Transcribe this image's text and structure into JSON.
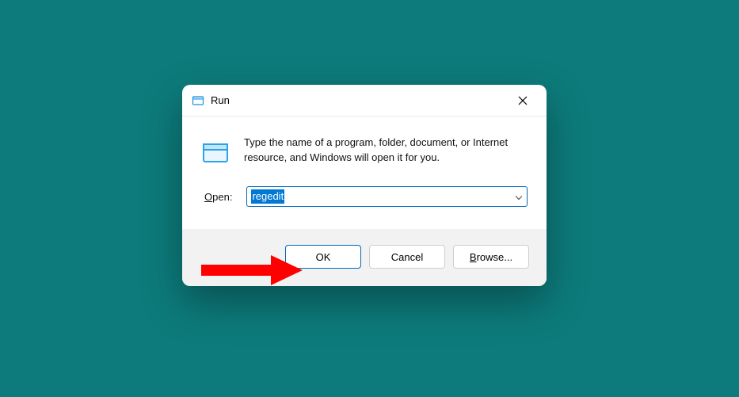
{
  "dialog": {
    "title": "Run",
    "description": "Type the name of a program, folder, document, or Internet resource, and Windows will open it for you.",
    "open_label_prefix": "O",
    "open_label_rest": "pen:",
    "input_value": "regedit",
    "buttons": {
      "ok": "OK",
      "cancel": "Cancel",
      "browse_prefix": "B",
      "browse_rest": "rowse..."
    }
  }
}
